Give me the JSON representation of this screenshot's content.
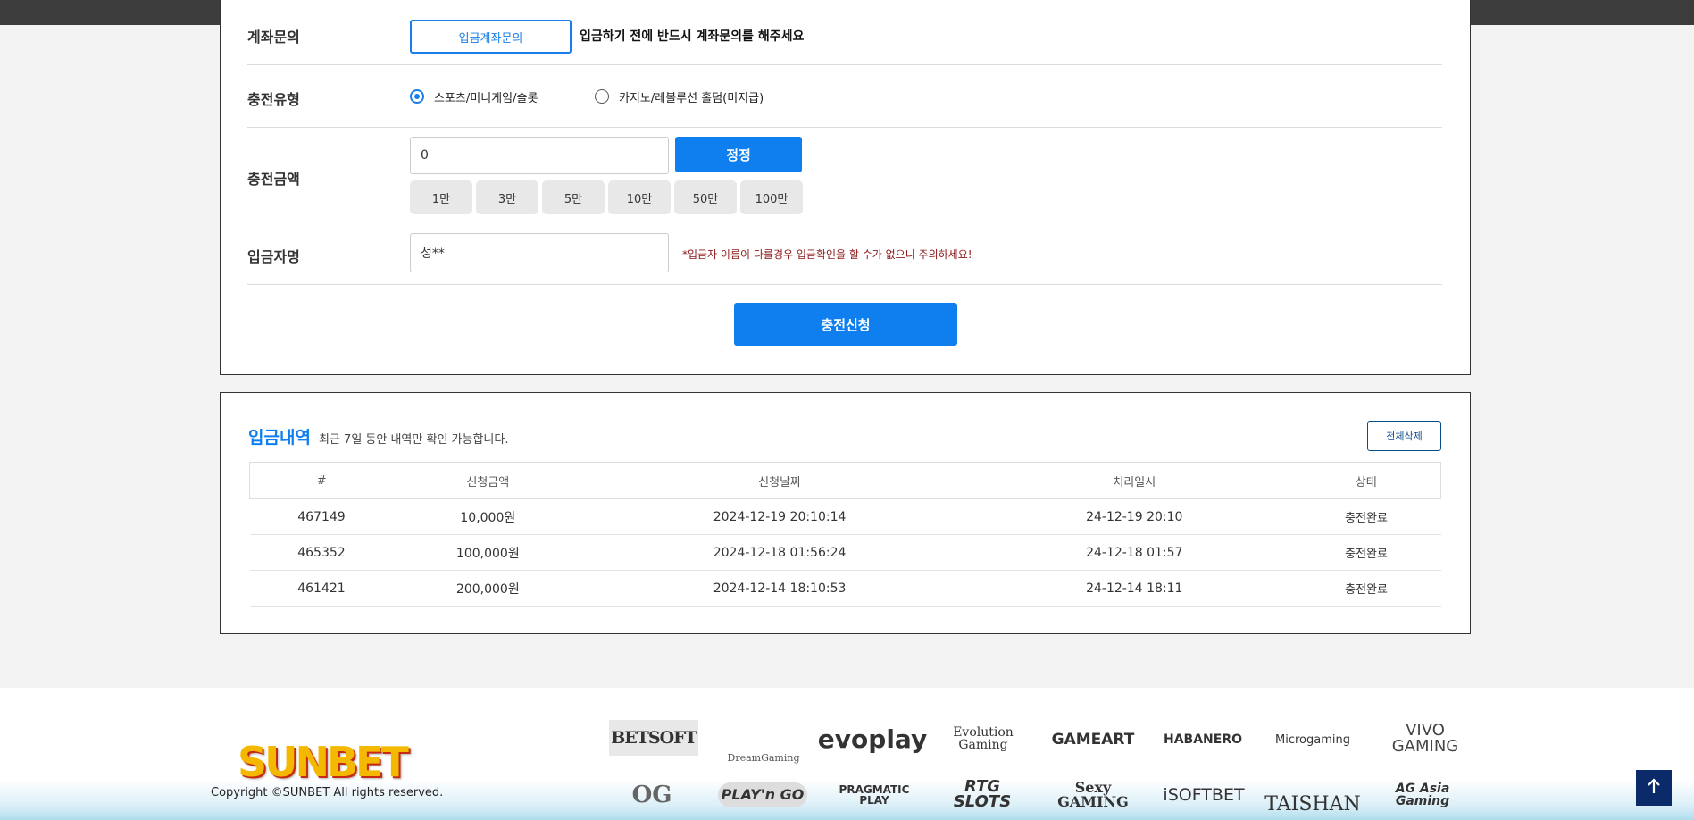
{
  "form": {
    "account_inquiry": {
      "label": "계좌문의",
      "button": "입금계좌문의",
      "notice": "입금하기 전에 반드시 계좌문의를 해주세요"
    },
    "charge_type": {
      "label": "충전유형",
      "options": [
        {
          "label": "스포츠/미니게임/슬롯",
          "selected": true
        },
        {
          "label": "카지노/레볼루션 홀덤(미지급)",
          "selected": false
        }
      ]
    },
    "charge_amount": {
      "label": "충전금액",
      "value": "0",
      "reset_button": "정정",
      "quick_amounts": [
        "1만",
        "3만",
        "5만",
        "10만",
        "50만",
        "100만"
      ]
    },
    "depositor": {
      "label": "입금자명",
      "value": "성**",
      "warning": "*입금자 이름이 다를경우 입금확인을 할 수가 없으니 주의하세요!"
    },
    "submit_button": "충전신청"
  },
  "history": {
    "title": "입금내역",
    "subtitle": "최근 7일 동안 내역만 확인 가능합니다.",
    "delete_all_button": "전체삭제",
    "columns": [
      "#",
      "신청금액",
      "신청날짜",
      "처리일시",
      "상태"
    ],
    "rows": [
      {
        "id": "467149",
        "amount": "10,000원",
        "requested": "2024-12-19 20:10:14",
        "processed": "24-12-19 20:10",
        "status": "충전완료"
      },
      {
        "id": "465352",
        "amount": "100,000원",
        "requested": "2024-12-18 01:56:24",
        "processed": "24-12-18 01:57",
        "status": "충전완료"
      },
      {
        "id": "461421",
        "amount": "200,000원",
        "requested": "2024-12-14 18:10:53",
        "processed": "24-12-14 18:11",
        "status": "충전완료"
      }
    ]
  },
  "footer": {
    "brand": "SUNBET",
    "copyright": "Copyright ©SUNBET All rights reserved.",
    "providers_row1": [
      "BETSOFT",
      "DreamGaming",
      "evoplay",
      "Evolution Gaming",
      "GAMEART",
      "HABANERO",
      "Microgaming",
      "VIVO GAMING"
    ],
    "providers_row2": [
      "OG",
      "PLAY'n GO",
      "PRAGMATIC PLAY",
      "RTG SLOTS",
      "Sexy GAMING",
      "iSOFTBET",
      "TAISHAN",
      "AG Asia Gaming"
    ]
  },
  "colors": {
    "accent": "#0f7ff0",
    "status_done": "#e0242a",
    "warning": "#8b1a1a"
  },
  "icons": {
    "scroll_top": "arrow-up-icon"
  }
}
